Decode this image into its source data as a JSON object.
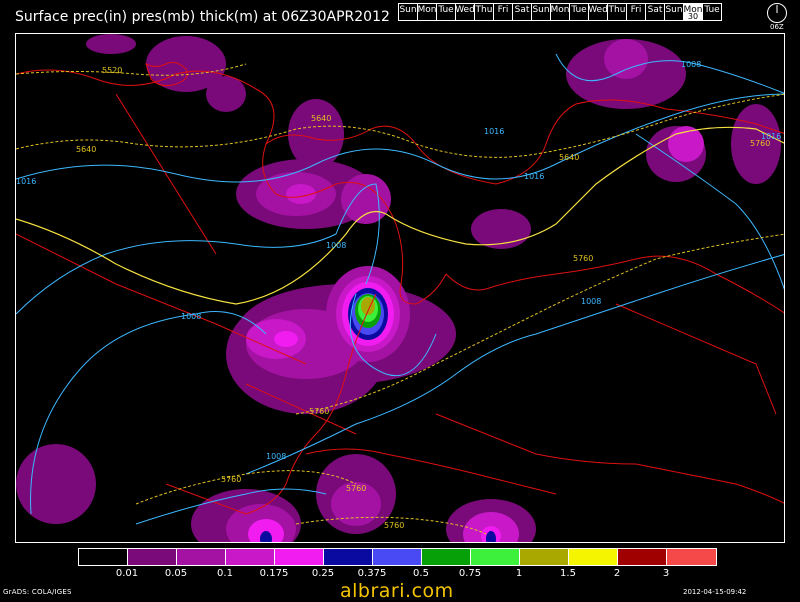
{
  "title": "Surface prec(in) pres(mb) thick(m) at 06Z30APR2012",
  "day_strip": [
    {
      "label": "Sun",
      "active": false
    },
    {
      "label": "Mon",
      "active": false
    },
    {
      "label": "Tue",
      "active": false
    },
    {
      "label": "Wed",
      "active": false
    },
    {
      "label": "Thu",
      "active": false
    },
    {
      "label": "Fri",
      "active": false
    },
    {
      "label": "Sat",
      "active": false
    },
    {
      "label": "Sun",
      "active": false
    },
    {
      "label": "Mon",
      "active": false
    },
    {
      "label": "Tue",
      "active": false
    },
    {
      "label": "Wed",
      "active": false
    },
    {
      "label": "Thu",
      "active": false
    },
    {
      "label": "Fri",
      "active": false
    },
    {
      "label": "Sat",
      "active": false
    },
    {
      "label": "Sun",
      "active": false
    },
    {
      "label": "Mon",
      "active": true,
      "day": "30"
    },
    {
      "label": "Tue",
      "active": false
    }
  ],
  "clock_label": "06Z",
  "map": {
    "isobar_labels": [
      "1016",
      "1016",
      "1016",
      "1016",
      "1008",
      "1008",
      "1008",
      "1008",
      "1008"
    ],
    "thickness_labels": [
      "5520",
      "5640",
      "5640",
      "5640",
      "5760",
      "5760",
      "5760",
      "5760",
      "5760",
      "5760"
    ]
  },
  "legend": {
    "colors": [
      "#000000",
      "#7a0a7a",
      "#a312a3",
      "#c818c8",
      "#f01cf0",
      "#0a0aa0",
      "#4a4af5",
      "#08a008",
      "#3cf03c",
      "#a8a800",
      "#f5f500",
      "#a00000",
      "#f54848"
    ],
    "labels": [
      "0.01",
      "0.05",
      "0.1",
      "0.175",
      "0.25",
      "0.375",
      "0.5",
      "0.75",
      "1",
      "1.5",
      "2",
      "3"
    ]
  },
  "footer": {
    "source": "GrADS: COLA/IGES",
    "timestamp": "2012-04-15-09:42"
  },
  "watermark": "albrari.com"
}
